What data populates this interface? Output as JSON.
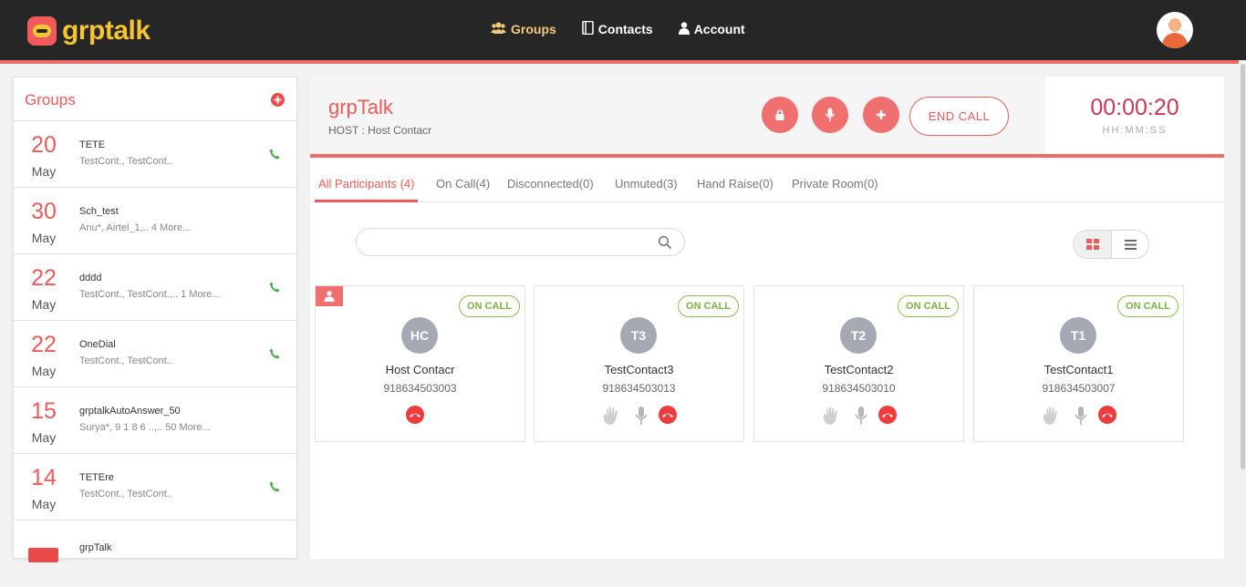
{
  "app": {
    "logo_text": "grptalk",
    "nav": [
      {
        "label": "Groups",
        "icon": "users-icon",
        "active": true
      },
      {
        "label": "Contacts",
        "icon": "address-book-icon",
        "active": false
      },
      {
        "label": "Account",
        "icon": "user-icon",
        "active": false
      }
    ]
  },
  "sidebar": {
    "title": "Groups",
    "groups": [
      {
        "day": "20",
        "month": "May",
        "name": "TETE",
        "members": "TestCont.,  TestCont..",
        "has_call": true
      },
      {
        "day": "30",
        "month": "May",
        "name": "Sch_test",
        "members": "Anu*,  Airtel_1,..  4 More...",
        "has_call": false
      },
      {
        "day": "22",
        "month": "May",
        "name": "dddd",
        "members": "TestCont.,  TestCont.,..  1 More...",
        "has_call": true
      },
      {
        "day": "22",
        "month": "May",
        "name": "OneDial",
        "members": "TestCont.,  TestCont..",
        "has_call": true
      },
      {
        "day": "15",
        "month": "May",
        "name": "grptalkAutoAnswer_50",
        "members": "Surya*,  9 1 8 6 ..,..  50 More...",
        "has_call": false
      },
      {
        "day": "14",
        "month": "May",
        "name": "TETEre",
        "members": "TestCont.,  TestCont..",
        "has_call": true
      },
      {
        "day": "",
        "month": "",
        "name": "grpTalk",
        "members": "",
        "has_call": false
      }
    ]
  },
  "call": {
    "title": "grpTalk",
    "host": "HOST : Host Contacr",
    "end_call_label": "END CALL",
    "timer": "00:00:20",
    "timer_label": "HH:MM:SS"
  },
  "tabs": [
    {
      "label": "All Participants (4)",
      "active": true
    },
    {
      "label": "On Call(4)",
      "active": false
    },
    {
      "label": "Disconnected(0)",
      "active": false
    },
    {
      "label": "Unmuted(3)",
      "active": false
    },
    {
      "label": "Hand Raise(0)",
      "active": false
    },
    {
      "label": "Private Room(0)",
      "active": false
    }
  ],
  "search": {
    "placeholder": "",
    "value": ""
  },
  "participants": [
    {
      "initials": "HC",
      "name": "Host  Contacr",
      "number": "918634503003",
      "status": "ON CALL",
      "is_host": true
    },
    {
      "initials": "T3",
      "name": "TestContact3",
      "number": "918634503013",
      "status": "ON CALL",
      "is_host": false
    },
    {
      "initials": "T2",
      "name": "TestContact2",
      "number": "918634503010",
      "status": "ON CALL",
      "is_host": false
    },
    {
      "initials": "T1",
      "name": "TestContact1",
      "number": "918634503007",
      "status": "ON CALL",
      "is_host": false
    }
  ],
  "colors": {
    "accent": "#ec5b5b",
    "topbar": "#262626",
    "logo": "#f7c431",
    "on_call": "#7cb342",
    "hangup": "#ef3b3b",
    "timer": "#c93a52"
  }
}
